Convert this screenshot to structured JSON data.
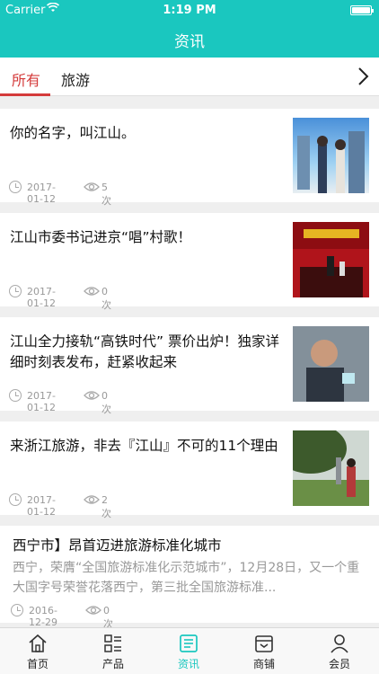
{
  "status_bar": {
    "carrier": "Carrier",
    "time": "1:19 PM"
  },
  "nav": {
    "title": "资讯"
  },
  "top_tabs": [
    {
      "label": "所有"
    },
    {
      "label": "旅游"
    }
  ],
  "articles": [
    {
      "title": "你的名字，叫江山。",
      "date": "2017-01-12",
      "views": "5次"
    },
    {
      "title": "江山市委书记进京“唱”村歌！",
      "date": "2017-01-12",
      "views": "0次"
    },
    {
      "title": "江山全力接轨“高铁时代” 票价出炉！独家详细时刻表发布，赶紧收起来",
      "date": "2017-01-12",
      "views": "0次"
    },
    {
      "title": "来浙江旅游，非去『江山』不可的11个理由",
      "date": "2017-01-12",
      "views": "2次"
    },
    {
      "title": "西宁市】昂首迈进旅游标准化城市",
      "summary": "西宁，荣膺“全国旅游标准化示范城市”，12月28日，又一个重大国字号荣誉花落西宁，第三批全国旅游标准...",
      "date": "2016-12-29",
      "views": "0次"
    }
  ],
  "bottom_tabs": [
    {
      "label": "首页"
    },
    {
      "label": "产品"
    },
    {
      "label": "资讯"
    },
    {
      "label": "商铺"
    },
    {
      "label": "会员"
    }
  ],
  "colors": {
    "theme": "#1ac7bf",
    "active_tab": "#d43b3b"
  }
}
